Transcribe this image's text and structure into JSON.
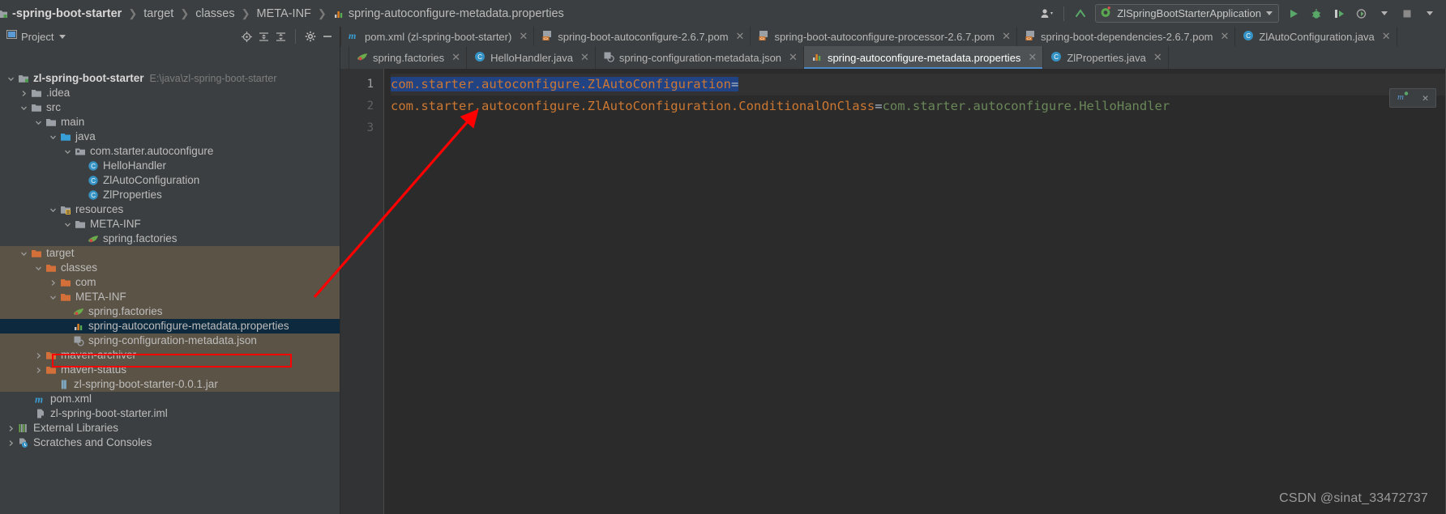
{
  "window": {
    "breadcrumb": [
      {
        "label": "-spring-boot-starter",
        "icon": "module-icon",
        "bold": true
      },
      {
        "label": "target",
        "icon": "",
        "bold": false
      },
      {
        "label": "classes",
        "icon": "",
        "bold": false
      },
      {
        "label": "META-INF",
        "icon": "",
        "bold": false
      },
      {
        "label": "spring-autoconfigure-metadata.properties",
        "icon": "properties-file-icon",
        "bold": false
      }
    ],
    "toolbar_right": {
      "user_icon": "user-dropdown-icon",
      "update_icon": "update-project-icon",
      "run_config": {
        "label": "ZlSpringBootStarterApplication",
        "icon": "spring-boot-run-icon"
      },
      "run_icon": "run-icon",
      "debug_icon": "debug-icon",
      "run_with_coverage_icon": "run-coverage-icon",
      "profile_icon": "profiler-icon",
      "stop_icon": "stop-icon"
    }
  },
  "project_panel": {
    "title": "Project",
    "tools": [
      "locate-icon",
      "expand-all-icon",
      "collapse-all-icon",
      "settings-icon",
      "hide-icon"
    ],
    "tree": [
      {
        "label": "zl-spring-boot-starter",
        "path": "E:\\java\\zl-spring-boot-starter",
        "depth": 0,
        "arrow": "down",
        "icon": "module-icon",
        "bold": true,
        "state": "normal"
      },
      {
        "label": ".idea",
        "depth": 1,
        "arrow": "right",
        "icon": "folder-icon",
        "state": "normal"
      },
      {
        "label": "src",
        "depth": 1,
        "arrow": "down",
        "icon": "folder-icon",
        "state": "normal"
      },
      {
        "label": "main",
        "depth": 2,
        "arrow": "down",
        "icon": "folder-icon",
        "state": "normal"
      },
      {
        "label": "java",
        "depth": 3,
        "arrow": "down",
        "icon": "source-folder-icon",
        "state": "normal"
      },
      {
        "label": "com.starter.autoconfigure",
        "depth": 4,
        "arrow": "down",
        "icon": "package-icon",
        "state": "normal"
      },
      {
        "label": "HelloHandler",
        "depth": 5,
        "arrow": "none",
        "icon": "java-class-icon",
        "state": "normal"
      },
      {
        "label": "ZlAutoConfiguration",
        "depth": 5,
        "arrow": "none",
        "icon": "java-class-icon",
        "state": "normal"
      },
      {
        "label": "ZlProperties",
        "depth": 5,
        "arrow": "none",
        "icon": "java-class-icon",
        "state": "normal"
      },
      {
        "label": "resources",
        "depth": 3,
        "arrow": "down",
        "icon": "resources-folder-icon",
        "state": "normal"
      },
      {
        "label": "META-INF",
        "depth": 4,
        "arrow": "down",
        "icon": "folder-icon",
        "state": "normal"
      },
      {
        "label": "spring.factories",
        "depth": 5,
        "arrow": "none",
        "icon": "spring-factories-icon",
        "state": "normal"
      },
      {
        "label": "target",
        "depth": 1,
        "arrow": "down",
        "icon": "excluded-folder-icon",
        "state": "excluded"
      },
      {
        "label": "classes",
        "depth": 2,
        "arrow": "down",
        "icon": "excluded-folder-icon",
        "state": "excluded"
      },
      {
        "label": "com",
        "depth": 3,
        "arrow": "right",
        "icon": "excluded-folder-icon",
        "state": "excluded"
      },
      {
        "label": "META-INF",
        "depth": 3,
        "arrow": "down",
        "icon": "excluded-folder-icon",
        "state": "excluded"
      },
      {
        "label": "spring.factories",
        "depth": 4,
        "arrow": "none",
        "icon": "spring-factories-icon",
        "state": "excluded"
      },
      {
        "label": "spring-autoconfigure-metadata.properties",
        "depth": 4,
        "arrow": "none",
        "icon": "properties-file-icon",
        "state": "selected"
      },
      {
        "label": "spring-configuration-metadata.json",
        "depth": 4,
        "arrow": "none",
        "icon": "json-metadata-icon",
        "state": "excluded"
      },
      {
        "label": "maven-archiver",
        "depth": 2,
        "arrow": "right",
        "icon": "excluded-folder-icon",
        "state": "excluded"
      },
      {
        "label": "maven-status",
        "depth": 2,
        "arrow": "right",
        "icon": "excluded-folder-icon",
        "state": "excluded"
      },
      {
        "label": "zl-spring-boot-starter-0.0.1.jar",
        "depth": 2,
        "arrow": "none",
        "icon": "jar-icon",
        "state": "excluded"
      },
      {
        "label": "pom.xml",
        "depth": 1,
        "arrow": "none",
        "icon": "maven-pom-icon",
        "state": "normal"
      },
      {
        "label": "zl-spring-boot-starter.iml",
        "depth": 1,
        "arrow": "none",
        "icon": "iml-icon",
        "state": "normal"
      },
      {
        "label": "External Libraries",
        "depth": 0,
        "arrow": "right",
        "icon": "libraries-icon",
        "state": "normal"
      },
      {
        "label": "Scratches and Consoles",
        "depth": 0,
        "arrow": "right",
        "icon": "scratches-icon",
        "state": "normal"
      }
    ]
  },
  "editor_tabs": {
    "row1": [
      {
        "label": "pom.xml (zl-spring-boot-starter)",
        "icon": "maven-pom-icon",
        "active": false,
        "closable": true
      },
      {
        "label": "spring-boot-autoconfigure-2.6.7.pom",
        "icon": "maven-pom-gray-icon",
        "active": false,
        "closable": true
      },
      {
        "label": "spring-boot-autoconfigure-processor-2.6.7.pom",
        "icon": "maven-pom-gray-icon",
        "active": false,
        "closable": true
      },
      {
        "label": "spring-boot-dependencies-2.6.7.pom",
        "icon": "maven-pom-gray-icon",
        "active": false,
        "closable": true
      },
      {
        "label": "ZlAutoConfiguration.java",
        "icon": "java-class-icon",
        "active": false,
        "closable": true
      }
    ],
    "row2": [
      {
        "label": "spring.factories",
        "icon": "spring-factories-icon",
        "active": false,
        "closable": true
      },
      {
        "label": "HelloHandler.java",
        "icon": "java-class-icon",
        "active": false,
        "closable": true
      },
      {
        "label": "spring-configuration-metadata.json",
        "icon": "json-metadata-icon",
        "active": false,
        "closable": true
      },
      {
        "label": "spring-autoconfigure-metadata.properties",
        "icon": "properties-file-icon",
        "active": true,
        "closable": true
      },
      {
        "label": "ZlProperties.java",
        "icon": "java-class-icon",
        "active": false,
        "closable": true
      }
    ]
  },
  "code": {
    "lines": [
      {
        "num": "1",
        "key": "com.starter.autoconfigure.ZlAutoConfiguration",
        "eq": "=",
        "value": "",
        "highlighted": true
      },
      {
        "num": "2",
        "key": "com.starter.autoconfigure.ZlAutoConfiguration.ConditionalOnClass",
        "eq": "=",
        "value": "com.starter.autoconfigure.HelloHandler",
        "highlighted": false
      },
      {
        "num": "3",
        "key": "",
        "eq": "",
        "value": "",
        "highlighted": false
      }
    ]
  },
  "annotations": {
    "highlight_rect": "red-rectangle-around-selected-file",
    "arrow": "red-arrow-pointing-to-selected-file"
  },
  "watermark": {
    "text": "CSDN @sinat_33472737"
  },
  "colors": {
    "background": "#3c3f41",
    "editor_background": "#2b2b2b",
    "selection": "#0d293e",
    "excluded": "#5b5345",
    "key_color": "#cc7832",
    "value_color": "#6a8759",
    "annotation": "#ff0000"
  }
}
